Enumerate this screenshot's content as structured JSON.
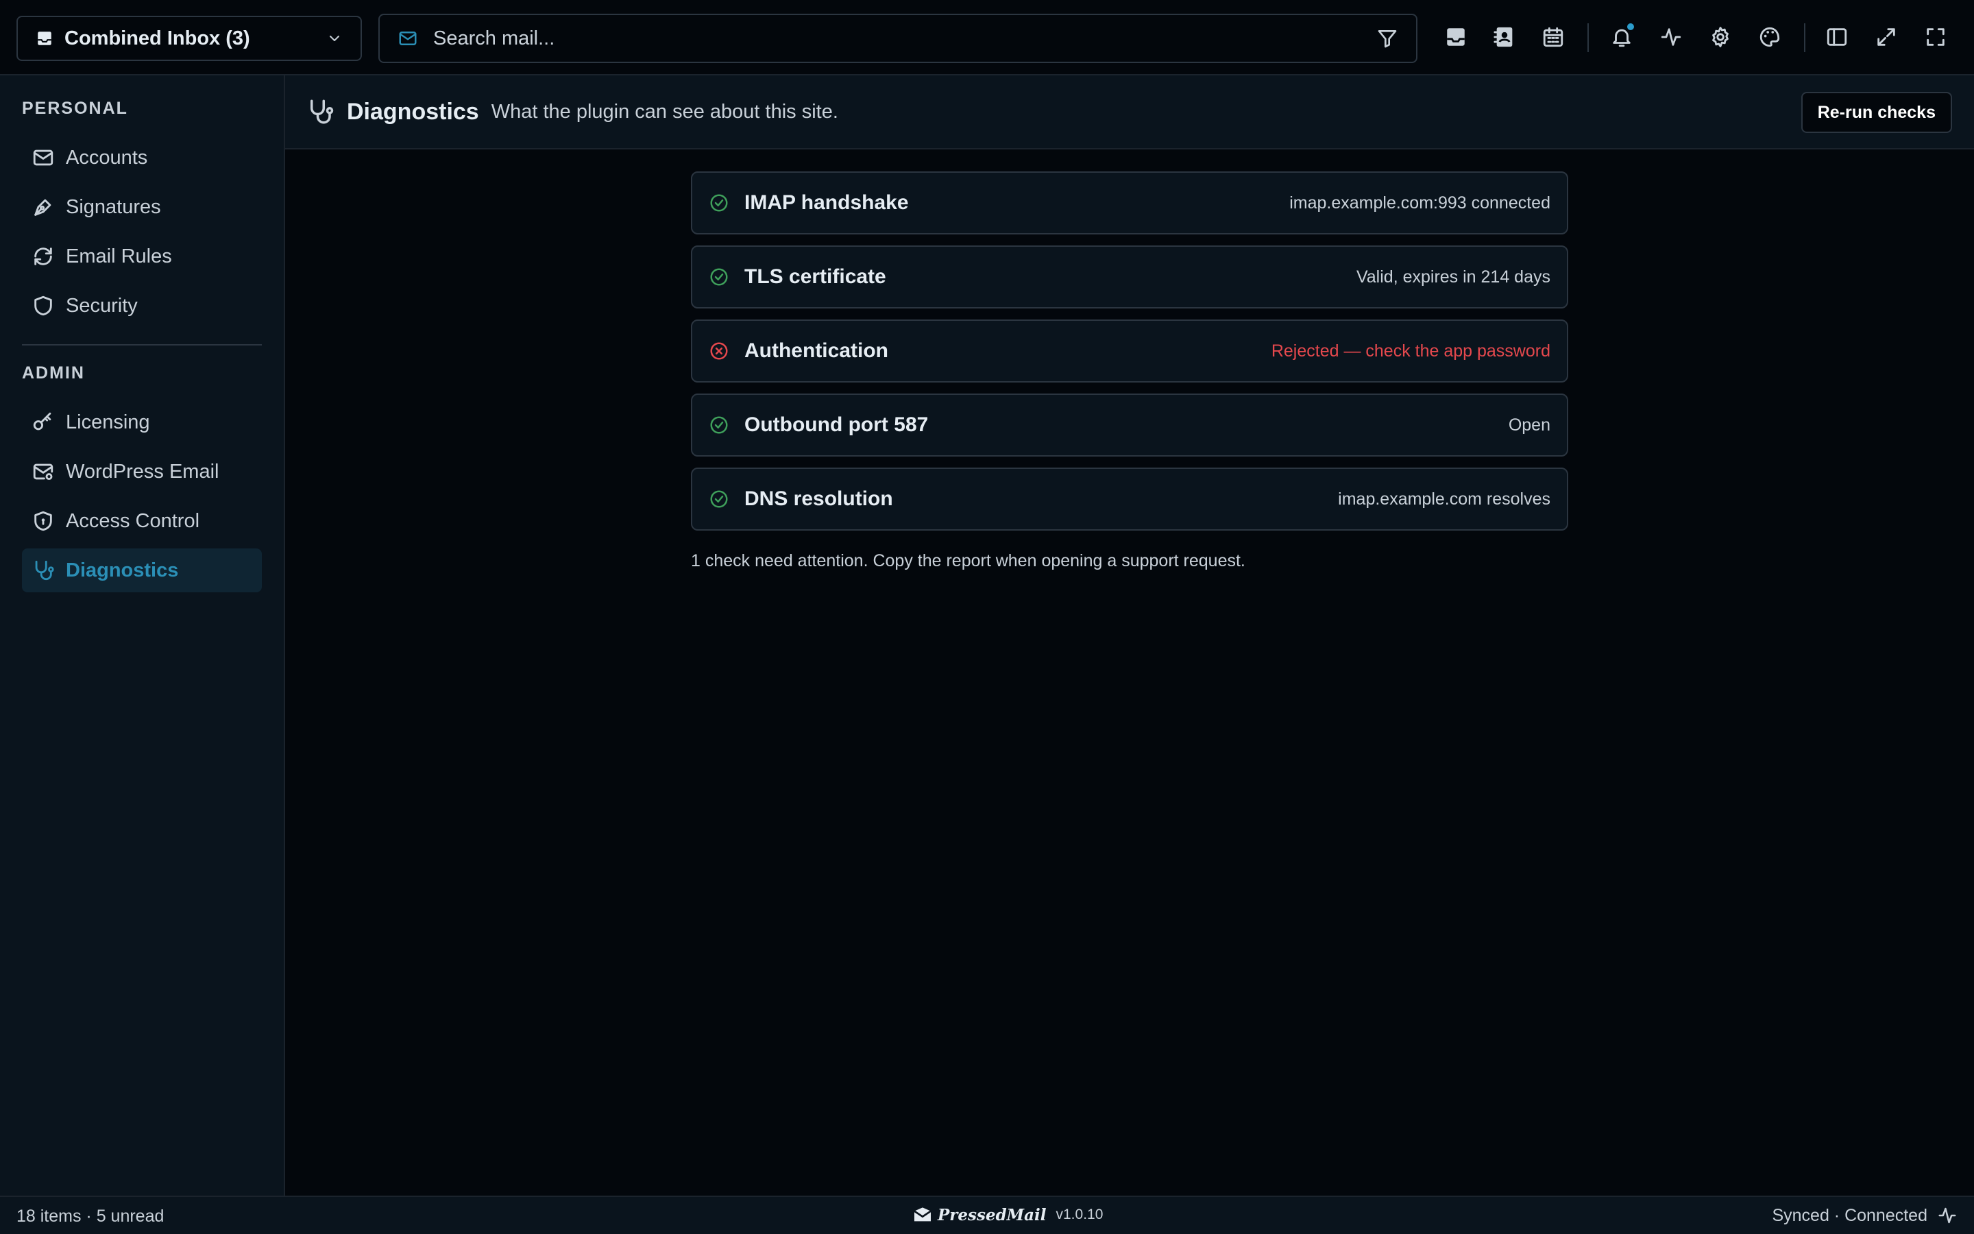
{
  "topbar": {
    "inbox_label": "Combined Inbox (3)",
    "search_placeholder": "Search mail...",
    "icons": [
      "inbox-icon",
      "contacts-icon",
      "calendar-icon",
      "bell-icon",
      "activity-icon",
      "gear-icon",
      "palette-icon",
      "sidebar-toggle-icon",
      "expand-icon",
      "fullscreen-icon"
    ]
  },
  "sidebar": {
    "personal_title": "PERSONAL",
    "admin_title": "ADMIN",
    "personal_items": [
      {
        "label": "Accounts",
        "icon": "mail-icon"
      },
      {
        "label": "Signatures",
        "icon": "pen-icon"
      },
      {
        "label": "Email Rules",
        "icon": "refresh-icon"
      },
      {
        "label": "Security",
        "icon": "shield-icon"
      }
    ],
    "admin_items": [
      {
        "label": "Licensing",
        "icon": "key-icon"
      },
      {
        "label": "WordPress Email",
        "icon": "mail-settings-icon"
      },
      {
        "label": "Access Control",
        "icon": "shield-lock-icon"
      },
      {
        "label": "Diagnostics",
        "icon": "stethoscope-icon",
        "active": true
      }
    ]
  },
  "main": {
    "title": "Diagnostics",
    "subtitle": "What the plugin can see about this site.",
    "rerun_label": "Re-run checks",
    "checks": [
      {
        "name": "IMAP handshake",
        "detail": "imap.example.com:993 connected",
        "status": "ok"
      },
      {
        "name": "TLS certificate",
        "detail": "Valid, expires in 214 days",
        "status": "ok"
      },
      {
        "name": "Authentication",
        "detail": "Rejected — check the app password",
        "status": "error"
      },
      {
        "name": "Outbound port 587",
        "detail": "Open",
        "status": "ok"
      },
      {
        "name": "DNS resolution",
        "detail": "imap.example.com resolves",
        "status": "ok"
      }
    ],
    "note": "1 check need attention. Copy the report when opening a support request."
  },
  "statusbar": {
    "left": "18 items · 5 unread",
    "brand": "PressedMail",
    "version": "v1.0.10",
    "right": "Synced · Connected"
  },
  "colors": {
    "accent": "#2b8fb6",
    "ok": "#3fa05b",
    "error": "#e5484d",
    "background": "#03070c",
    "panel": "#0a141d"
  }
}
